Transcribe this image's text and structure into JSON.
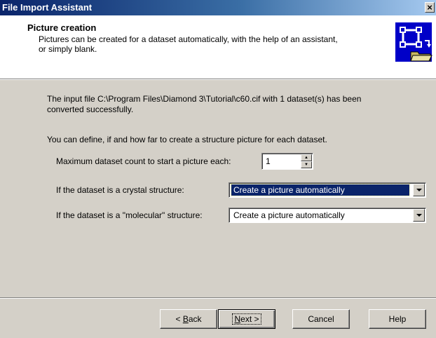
{
  "window": {
    "title": "File Import Assistant",
    "close_glyph": "×"
  },
  "header": {
    "title": "Picture creation",
    "desc_line1": "Pictures can be created for a dataset automatically, with the help of an assistant,",
    "desc_line2": "or simply blank.",
    "icon": "picture-folder-icon"
  },
  "body": {
    "info_line1": "The input file C:\\Program Files\\Diamond 3\\Tutorial\\c60.cif with 1 dataset(s) has been",
    "info_line2": "converted successfully.",
    "define_text": "You can define, if and how far to create a structure picture for each dataset.",
    "max_count_label": "Maximum dataset count to start a picture each:",
    "max_count_value": "1",
    "crystal_label": "If the dataset is a crystal structure:",
    "crystal_value": "Create a picture automatically",
    "molecular_label": "If the dataset is a \"molecular\" structure:",
    "molecular_value": "Create a picture automatically"
  },
  "buttons": {
    "back_prefix": "< ",
    "back_mnemonic": "B",
    "back_rest": "ack",
    "next_mnemonic": "N",
    "next_rest": "ext >",
    "cancel": "Cancel",
    "help": "Help"
  },
  "colors": {
    "title_active": "#0a246a",
    "face": "#d4d0c8",
    "highlight": "#0a246a"
  }
}
